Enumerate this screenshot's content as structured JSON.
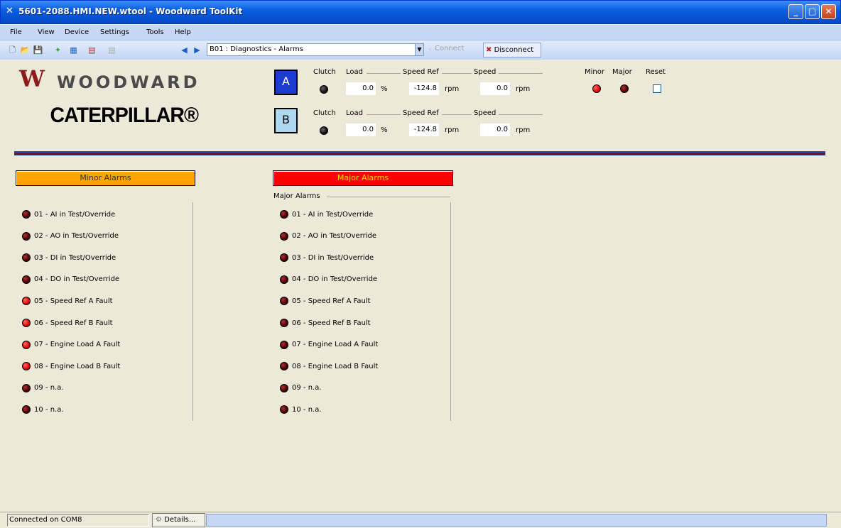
{
  "window": {
    "title": "5601-2088.HMI.NEW.wtool - Woodward ToolKit"
  },
  "menu": [
    "File",
    "View",
    "Device",
    "Settings",
    "Tools",
    "Help"
  ],
  "toolbar": {
    "page_select": "B01 : Diagnostics - Alarms",
    "connect_label": "Connect",
    "disconnect_label": "Disconnect"
  },
  "logos": {
    "woodward": "WOODWARD",
    "caterpillar": "CATERPILLAR®"
  },
  "engines": [
    {
      "button": "A",
      "clutch_label": "Clutch",
      "load_label": "Load",
      "load_value": "0.0",
      "load_unit": "%",
      "speedref_label": "Speed Ref",
      "speedref_value": "-124.8",
      "speedref_unit": "rpm",
      "speed_label": "Speed",
      "speed_value": "0.0",
      "speed_unit": "rpm",
      "clutch_state": "off"
    },
    {
      "button": "B",
      "clutch_label": "Clutch",
      "load_label": "Load",
      "load_value": "0.0",
      "load_unit": "%",
      "speedref_label": "Speed Ref",
      "speedref_value": "-124.8",
      "speedref_unit": "rpm",
      "speed_label": "Speed",
      "speed_value": "0.0",
      "speed_unit": "rpm",
      "clutch_state": "off"
    }
  ],
  "summary": {
    "minor_label": "Minor",
    "major_label": "Major",
    "reset_label": "Reset",
    "minor_state": "on",
    "major_state": "off"
  },
  "minor_alarms": {
    "header": "Minor Alarms",
    "items": [
      {
        "label": "01 - AI in Test/Override",
        "state": "off"
      },
      {
        "label": "02 - AO in Test/Override",
        "state": "off"
      },
      {
        "label": "03 - DI in Test/Override",
        "state": "off"
      },
      {
        "label": "04 - DO in Test/Override",
        "state": "off"
      },
      {
        "label": "05 - Speed Ref A Fault",
        "state": "on"
      },
      {
        "label": "06 - Speed Ref B Fault",
        "state": "on"
      },
      {
        "label": "07 - Engine Load A Fault",
        "state": "on"
      },
      {
        "label": "08 - Engine Load B Fault",
        "state": "on"
      },
      {
        "label": "09 - n.a.",
        "state": "off"
      },
      {
        "label": "10 - n.a.",
        "state": "off"
      }
    ]
  },
  "major_alarms": {
    "header": "Major Alarms",
    "group_label": "Major Alarms",
    "items": [
      {
        "label": "01 - AI in Test/Override",
        "state": "off"
      },
      {
        "label": "02 - AO in Test/Override",
        "state": "off"
      },
      {
        "label": "03 - DI in Test/Override",
        "state": "off"
      },
      {
        "label": "04 - DO in Test/Override",
        "state": "off"
      },
      {
        "label": "05 - Speed Ref A Fault",
        "state": "off"
      },
      {
        "label": "06 - Speed Ref B Fault",
        "state": "off"
      },
      {
        "label": "07 - Engine Load A Fault",
        "state": "off"
      },
      {
        "label": "08 - Engine Load B Fault",
        "state": "off"
      },
      {
        "label": "09 - n.a.",
        "state": "off"
      },
      {
        "label": "10 - n.a.",
        "state": "off"
      }
    ]
  },
  "status": {
    "connection": "Connected on COM8",
    "details_label": "Details..."
  }
}
